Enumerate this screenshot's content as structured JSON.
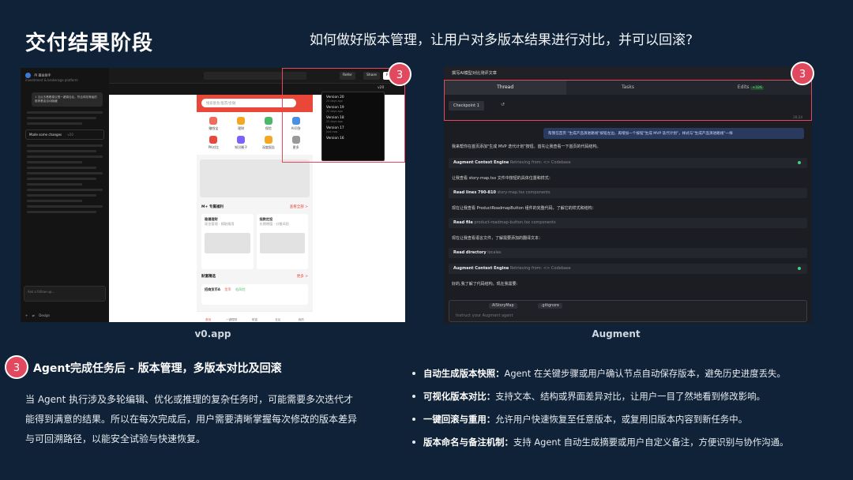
{
  "slide": {
    "title": "交付结果阶段",
    "subtitle": "如何做好版本管理，让用户对多版本结果进行对比，并可以回滚?"
  },
  "left_shot": {
    "caption": "v0.app",
    "badge": "3",
    "chat": {
      "header": "AI 基金助手",
      "header_sub": "investment & brokerage platform",
      "bubble": "1 当点击看看建议根一键调仓后，符合风险等级的推荐基金自动隐藏",
      "made_changes": "Made some changes",
      "made_changes_ver": "v20",
      "follow_up_placeholder": "Ask a follow-up...",
      "mode": "Design"
    },
    "topbar": {
      "refer": "Refer",
      "share": "Share",
      "publish": "Publish",
      "version": "v20"
    },
    "versions": [
      {
        "name": "Version 20",
        "time": "20 days ago"
      },
      {
        "name": "Version 19",
        "time": "20 days ago"
      },
      {
        "name": "Version 18",
        "time": "20 days ago"
      },
      {
        "name": "Version 17",
        "time": "Just now"
      },
      {
        "name": "Version 16",
        "time": ""
      }
    ],
    "phone": {
      "search_placeholder": "搜索基金/股票/金融",
      "grid": [
        {
          "label": "赚钱宝",
          "color": "#f06b5a"
        },
        {
          "label": "理财",
          "color": "#f5a623"
        },
        {
          "label": "保险",
          "color": "#4cb96a"
        },
        {
          "label": "AI问答",
          "color": "#4a90e2"
        },
        {
          "label": "PK对比",
          "color": "#e8473a"
        },
        {
          "label": "知识圈子",
          "color": "#7b61ff"
        },
        {
          "label": "深度报告",
          "color": "#f5a623"
        },
        {
          "label": "更多",
          "color": "#999999"
        }
      ],
      "section_title": "M+ 专属福利",
      "section_more": "查看全部 >",
      "card1_title": "稳健理财",
      "card1_sub": "现金管理 · 随取随用",
      "card2_title": "指数定投",
      "card2_sub": "长期增值 · 分散风险",
      "fund_section": "财富精选",
      "fund_more": "更多 >",
      "fund_name": "招商货币A",
      "fund_tag1": "货币",
      "fund_tag2": "低风险",
      "tabs": [
        "首页",
        "一键理财",
        "财富",
        "社区",
        "我的"
      ]
    }
  },
  "right_shot": {
    "caption": "Augment",
    "badge": "3",
    "title": "撰写AI模型对比测评文章",
    "tabs": {
      "thread": "Thread",
      "tasks": "Tasks",
      "edits": "Edits",
      "edits_count": "+326"
    },
    "checkpoint": "Checkpoint 1",
    "time": "16:24",
    "user_msg": "帮我在首页 \"生成产品演进路线\"按钮左边，再增加一个按钮\"生成 MVP 迭代计划\"，样式与\"生成产品演进路线\"一样",
    "lines": [
      "我来帮你在首页添加\"生成 MVP 迭代计划\"按钮。首先让我查看一下首页的代码结构。",
      "让我查看 story-map.tsx 文件中按钮的具体位置和样式：",
      "现在让我查看 ProductRoadmapButton 组件的完整代码，了解它的样式和结构：",
      "现在让我查看语言文件，了解需要添加的翻译文本：",
      "好的,我了解了代码结构。现在我需要:"
    ],
    "tools": [
      {
        "name": "Augment Context Engine",
        "detail": "Retrieving from: <> Codebase"
      },
      {
        "name": "Read lines 790-810",
        "detail": "story-map.tsx components"
      },
      {
        "name": "Read file",
        "detail": "product-roadmap-button.tsx components"
      },
      {
        "name": "Read directory",
        "detail": "locales"
      },
      {
        "name": "Augment Context Engine",
        "detail": "Retrieving from: <> Codebase"
      }
    ],
    "input": {
      "chip1": "AIStoryMap",
      "chip2": ".gitignore",
      "placeholder": "Instruct your Augment agent"
    }
  },
  "section": {
    "badge": "3",
    "title": "Agent完成任务后 - 版本管理，多版本对比及回滚",
    "para": "当 Agent 执行涉及多轮编辑、优化或推理的复杂任务时，可能需要多次迭代才能得到满意的结果。所以在每次完成后，用户需要清晰掌握每次修改的版本差异与可回溯路径，以能安全试验与快速恢复。"
  },
  "bullets": [
    {
      "head": "自动生成版本快照：",
      "body": "Agent 在关键步骤或用户确认节点自动保存版本，避免历史进度丢失。"
    },
    {
      "head": "可视化版本对比：",
      "body": "支持文本、结构或界面差异对比，让用户一目了然地看到修改影响。"
    },
    {
      "head": "一键回滚与重用：",
      "body": "允许用户快速恢复至任意版本，或复用旧版本内容到新任务中。"
    },
    {
      "head": "版本命名与备注机制：",
      "body": "支持 Agent 自动生成摘要或用户自定义备注，方便识别与协作沟通。"
    }
  ],
  "colors": {
    "background": "#0f2237",
    "accent": "#e14a5e"
  }
}
